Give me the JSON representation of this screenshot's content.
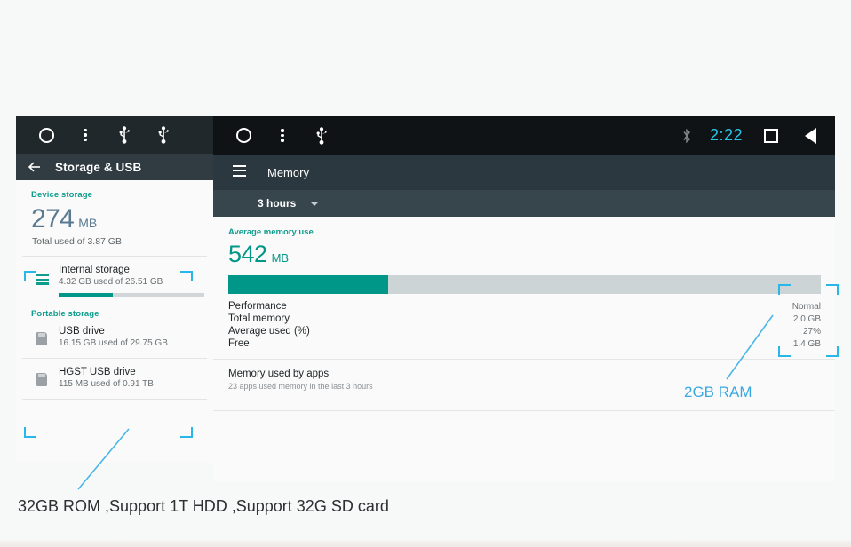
{
  "left_panel": {
    "statusbar": {
      "icons": [
        "home-circle-icon",
        "overflow-menu-icon",
        "usb-icon",
        "usb-icon"
      ]
    },
    "toolbar": {
      "back_icon": "back-arrow-icon",
      "title": "Storage & USB"
    },
    "device_storage": {
      "section_label": "Device storage",
      "amount": "274",
      "unit": "MB",
      "total_line": "Total used of 3.87 GB"
    },
    "internal": {
      "icon": "storage-lines-icon",
      "name": "Internal storage",
      "sub": "4.32 GB used of 26.51 GB",
      "bar_percent": 37
    },
    "portable_label": "Portable storage",
    "portable": [
      {
        "icon": "sd-card-icon",
        "name": "USB drive",
        "sub": "16.15 GB used of 29.75 GB"
      },
      {
        "icon": "sd-card-icon",
        "name": "HGST USB drive",
        "sub": "115 MB used of 0.91 TB"
      }
    ]
  },
  "right_panel": {
    "statusbar": {
      "left_icons": [
        "home-circle-icon",
        "overflow-menu-icon",
        "usb-icon"
      ],
      "bluetooth_icon": "bluetooth-icon",
      "clock": "2:22",
      "recents_icon": "recents-square-icon",
      "back_icon": "back-triangle-icon"
    },
    "toolbar": {
      "menu_icon": "hamburger-menu-icon",
      "title": "Memory"
    },
    "subbar": {
      "selected_range": "3 hours",
      "caret_icon": "chevron-down-icon"
    },
    "memory": {
      "section_label": "Average memory use",
      "amount": "542",
      "unit": "MB",
      "bar_percent": 27,
      "stats": [
        {
          "key": "Performance",
          "value": "Normal"
        },
        {
          "key": "Total memory",
          "value": "2.0 GB"
        },
        {
          "key": "Average used (%)",
          "value": "27%"
        },
        {
          "key": "Free",
          "value": "1.4 GB"
        }
      ]
    },
    "apps": {
      "title": "Memory used by apps",
      "sub": "23 apps used memory in the last 3 hours"
    }
  },
  "annotations": {
    "ram_callout": "2GB RAM",
    "rom_callout": "32GB ROM ,Support 1T HDD ,Support 32G SD card"
  },
  "colors": {
    "teal": "#009688",
    "teal_label": "#0f9d8e",
    "callout_blue": "#29b6e8",
    "clock_cyan": "#27c6e8",
    "statusbar_dark": "#101315",
    "toolbar_dark": "#2b3840"
  }
}
